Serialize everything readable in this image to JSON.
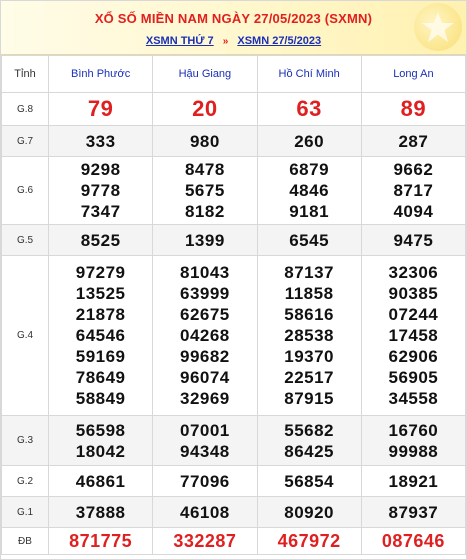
{
  "header": {
    "title": "XỔ SỐ MIỀN NAM NGÀY 27/05/2023 (SXMN)",
    "links": [
      "XSMN THỨ 7",
      "XSMN 27/5/2023"
    ],
    "separator": "»"
  },
  "table": {
    "label_header": "Tỉnh",
    "provinces": [
      "Bình Phước",
      "Hậu Giang",
      "Hồ Chí Minh",
      "Long An"
    ],
    "rows": [
      {
        "label": "G.8",
        "style": "big",
        "values": [
          [
            "79"
          ],
          [
            "20"
          ],
          [
            "63"
          ],
          [
            "89"
          ]
        ]
      },
      {
        "label": "G.7",
        "style": "normal",
        "values": [
          [
            "333"
          ],
          [
            "980"
          ],
          [
            "260"
          ],
          [
            "287"
          ]
        ]
      },
      {
        "label": "G.6",
        "style": "normal",
        "values": [
          [
            "9298",
            "9778",
            "7347"
          ],
          [
            "8478",
            "5675",
            "8182"
          ],
          [
            "6879",
            "4846",
            "9181"
          ],
          [
            "9662",
            "8717",
            "4094"
          ]
        ]
      },
      {
        "label": "G.5",
        "style": "normal",
        "values": [
          [
            "8525"
          ],
          [
            "1399"
          ],
          [
            "6545"
          ],
          [
            "9475"
          ]
        ]
      },
      {
        "label": "G.4",
        "style": "normal",
        "values": [
          [
            "97279",
            "13525",
            "21878",
            "64546",
            "59169",
            "78649",
            "58849"
          ],
          [
            "81043",
            "63999",
            "62675",
            "04268",
            "99682",
            "96074",
            "32969"
          ],
          [
            "87137",
            "11858",
            "58616",
            "28538",
            "19370",
            "22517",
            "87915"
          ],
          [
            "32306",
            "90385",
            "07244",
            "17458",
            "62906",
            "56905",
            "34558"
          ]
        ]
      },
      {
        "label": "G.3",
        "style": "normal",
        "values": [
          [
            "56598",
            "18042"
          ],
          [
            "07001",
            "94348"
          ],
          [
            "55682",
            "86425"
          ],
          [
            "16760",
            "99988"
          ]
        ]
      },
      {
        "label": "G.2",
        "style": "normal",
        "values": [
          [
            "46861"
          ],
          [
            "77096"
          ],
          [
            "56854"
          ],
          [
            "18921"
          ]
        ]
      },
      {
        "label": "G.1",
        "style": "normal",
        "values": [
          [
            "37888"
          ],
          [
            "46108"
          ],
          [
            "80920"
          ],
          [
            "87937"
          ]
        ]
      },
      {
        "label": "ĐB",
        "style": "special",
        "values": [
          [
            "871775"
          ],
          [
            "332287"
          ],
          [
            "467972"
          ],
          [
            "087646"
          ]
        ]
      }
    ]
  },
  "colors": {
    "accent_red": "#e02020",
    "link_blue": "#1a2fb8",
    "header_bg": "#fff7cc"
  },
  "icons": {
    "badge": "star-icon"
  }
}
